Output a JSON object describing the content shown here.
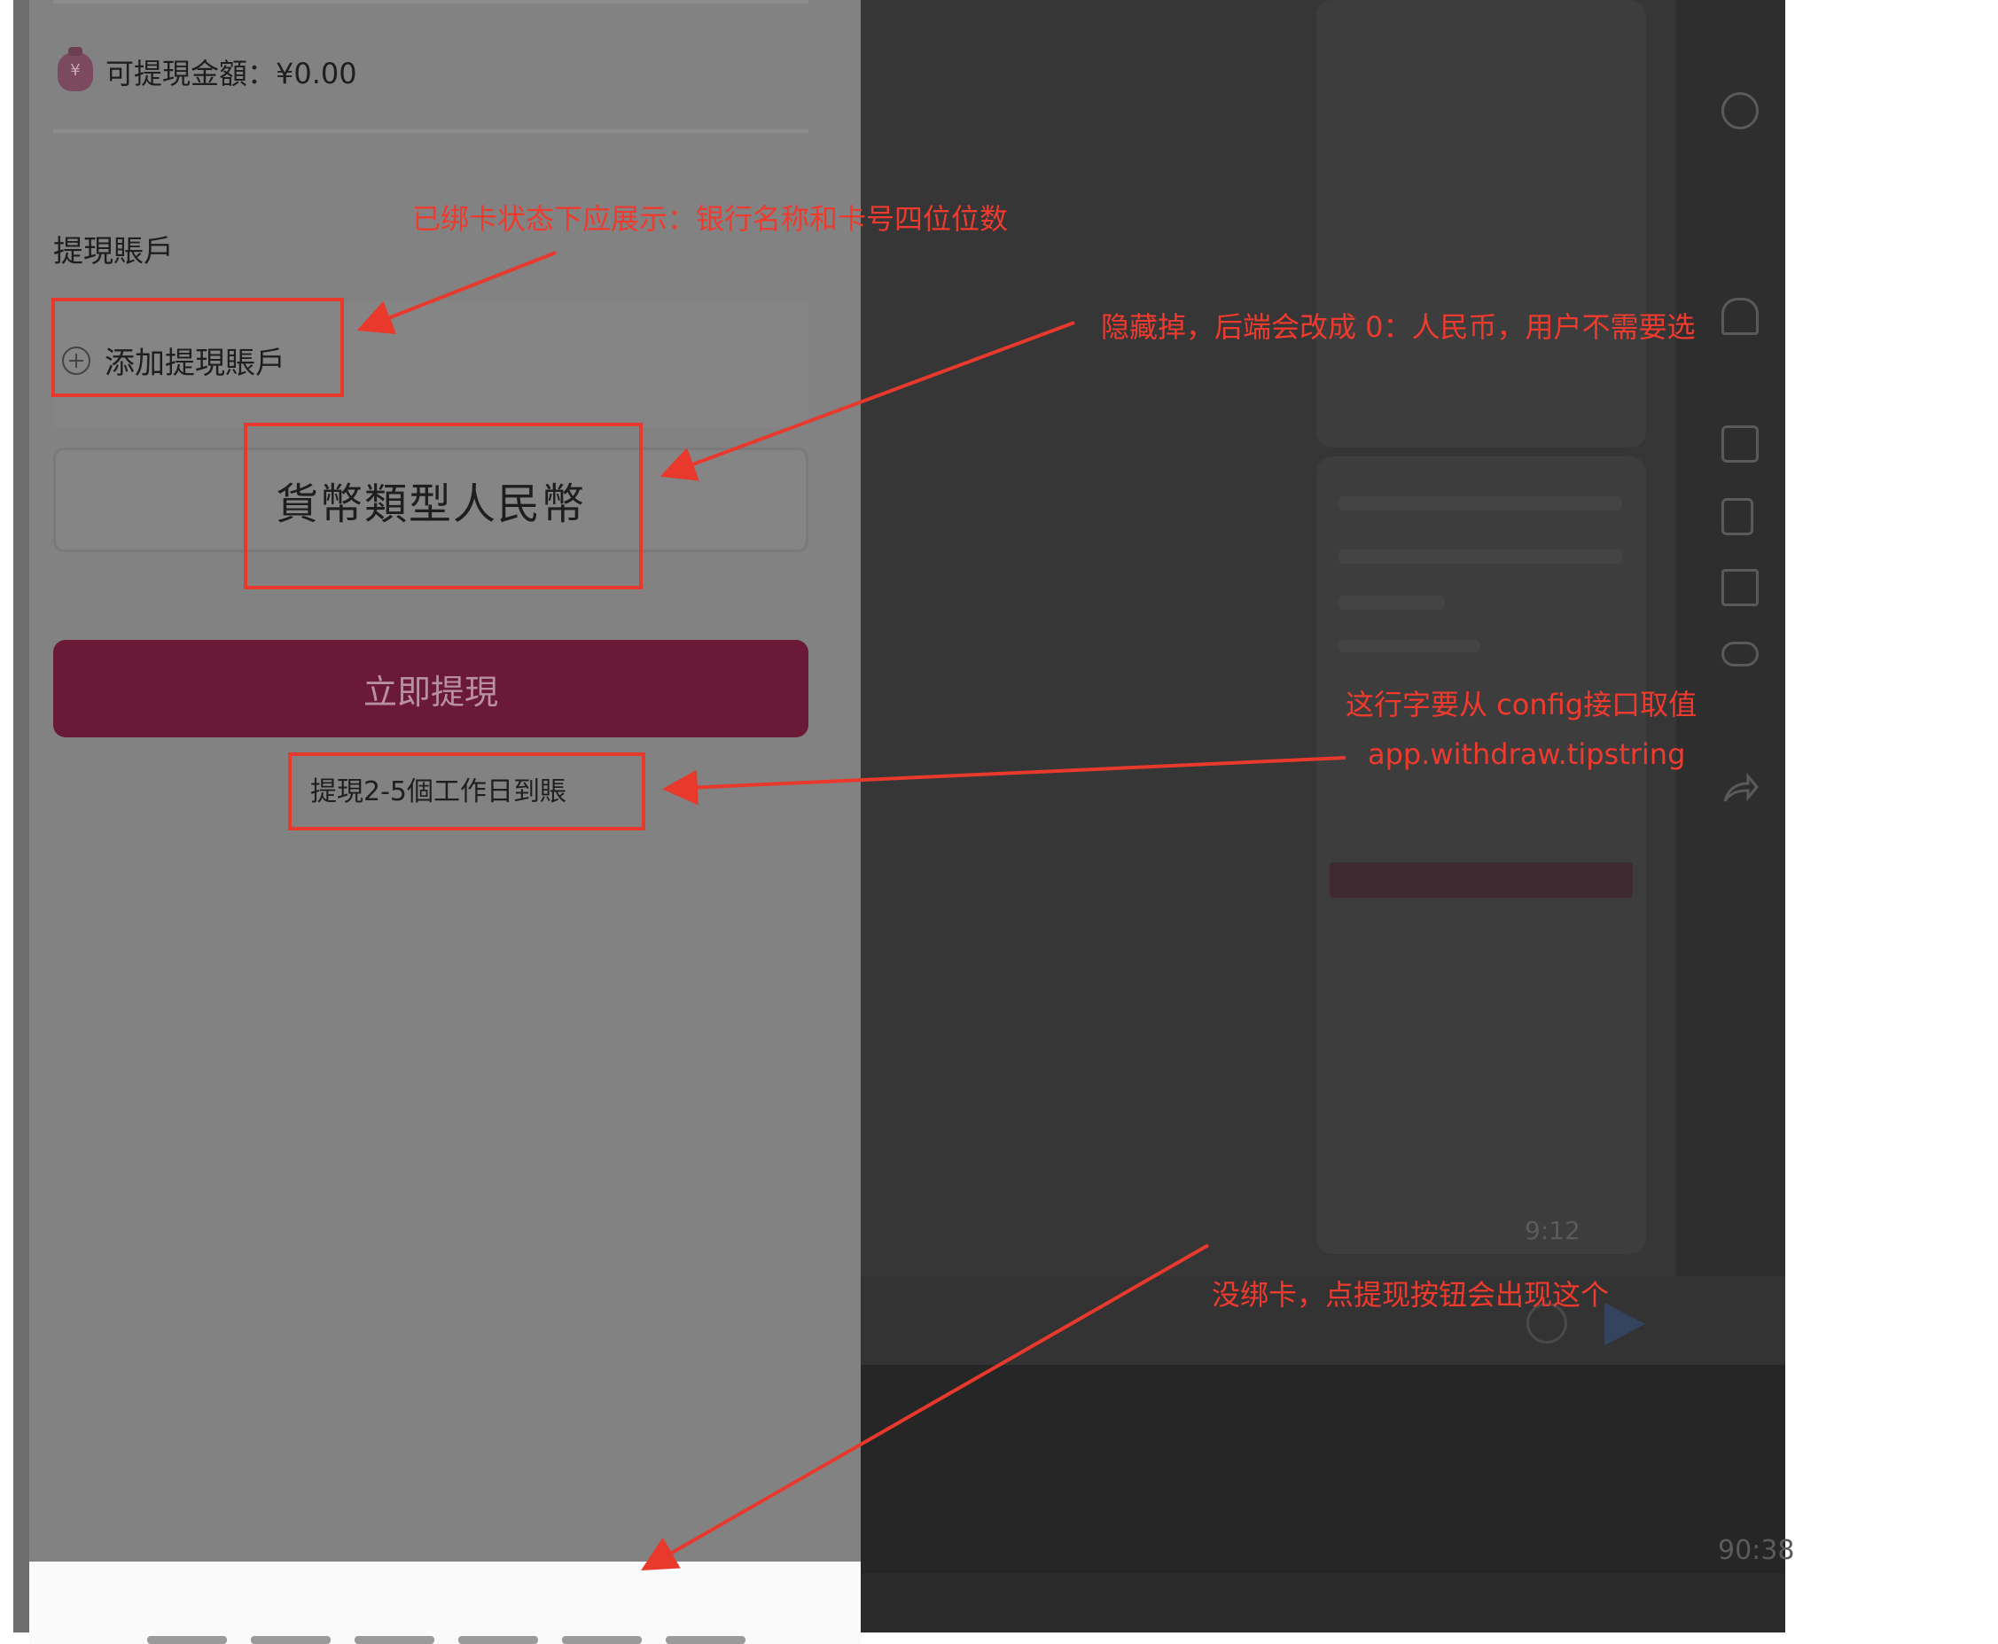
{
  "withdraw": {
    "available_amount": "可提現金額：¥0.00",
    "account_section_title": "提現賬戶",
    "add_account_label": "添加提現賬戶",
    "currency_type": "貨幣類型人民幣",
    "withdraw_button": "立即提現",
    "tip": "提現2-5個工作日到賬"
  },
  "background": {
    "bubble_time": "9:12",
    "bottom_time": "90:38"
  },
  "annotations": {
    "bank_card_note": "已绑卡状态下应展示：银行名称和卡号四位位数",
    "currency_note": "隐藏掉，后端会改成 0：人民币，用户不需要选",
    "config_note_line1": "这行字要从 config接口取值",
    "config_note_line2": "app.withdraw.tipstring",
    "no_card_note": "没绑卡，点提现按钮会出现这个"
  },
  "colors": {
    "annotation_red": "#e8392c",
    "button_bg": "#6a1937"
  }
}
